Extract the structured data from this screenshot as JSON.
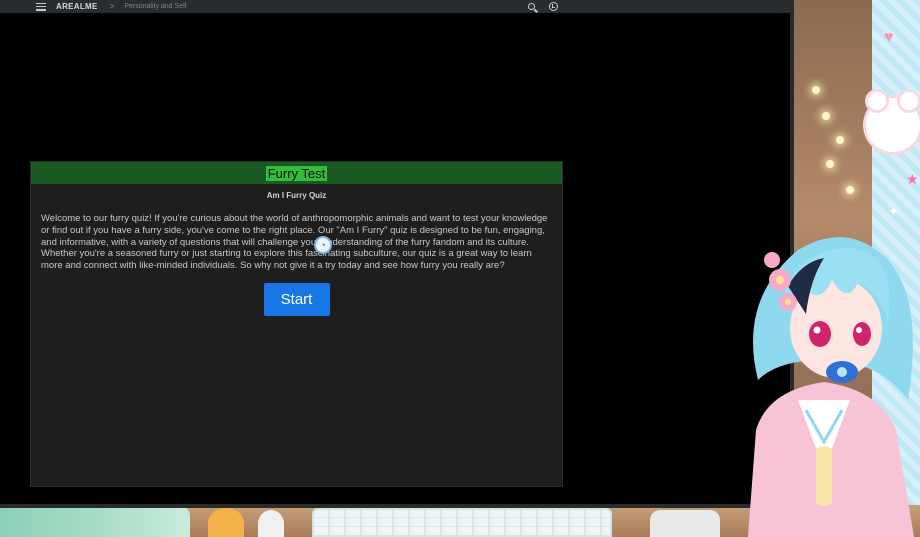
{
  "browser": {
    "brand": "AREALME",
    "breadcrumb_separator": ">",
    "breadcrumb": "Personality and Self"
  },
  "quiz": {
    "title": "Furry Test",
    "subtitle": "Am I Furry Quiz",
    "description": "Welcome to our furry quiz! If you're curious about the world of anthropomorphic animals and want to test your knowledge or find out if you have a furry side, you've come to the right place. Our \"Am I Furry\" quiz is designed to be fun, engaging, and informative, with a variety of questions that will challenge your understanding of the furry fandom and its culture. Whether you're a seasoned furry or just starting to explore this fascinating subculture, our quiz is a great way to learn more and connect with like-minded individuals. So why not give it a try today and see how furry you really are?",
    "start_label": "Start"
  },
  "colors": {
    "header_green": "#1c5a24",
    "title_highlight": "#2fbf3a",
    "start_blue": "#1877e6",
    "card_bg": "#1e1e1e"
  },
  "icons": {
    "menu": "menu-icon",
    "search": "search-icon",
    "history": "history-icon",
    "cursor": "cursor-icon"
  }
}
